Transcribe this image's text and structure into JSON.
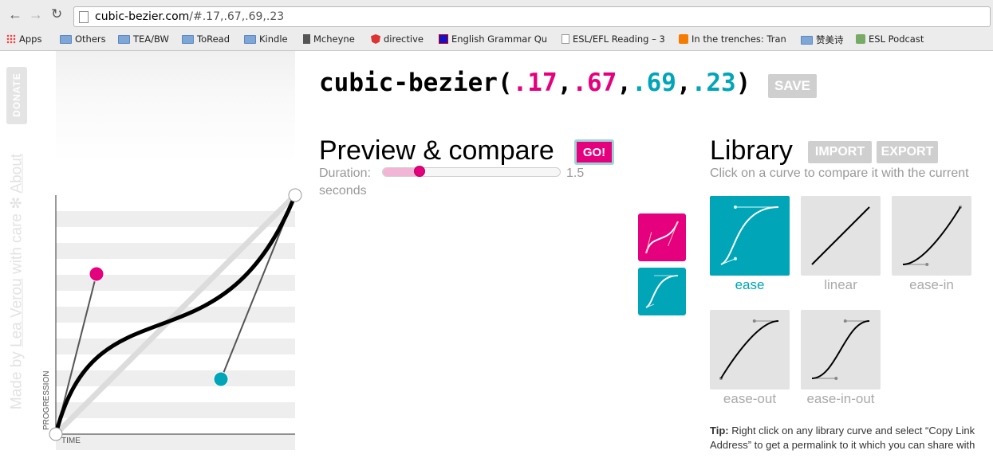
{
  "browser": {
    "url_host": "cubic-bezier.com",
    "url_rest": "/#.17,.67,.69,.23",
    "bookmarks": [
      "Apps",
      "Others",
      "TEA/BW",
      "ToRead",
      "Kindle",
      "Mcheyne",
      "directive",
      "English Grammar Qu",
      "ESL/EFL Reading – 3",
      "In the trenches: Tran",
      "赞美诗",
      "ESL Podcast"
    ]
  },
  "sidebar": {
    "donate": "DONATE",
    "made_by": "Made by",
    "author": "Lea Verou",
    "with_care": "with care",
    "star": "✻",
    "about": "About"
  },
  "graph": {
    "y_label": "PROGRESSION",
    "x_label": "TIME",
    "p1": [
      0.17,
      0.67
    ],
    "p2": [
      0.69,
      0.23
    ],
    "p1_color": "#e5007d",
    "p2_color": "#00a5b7"
  },
  "header": {
    "prefix": "cubic-bezier(",
    "v1": ".17",
    "c1": ",",
    "v2": ".67",
    "c2": ",",
    "v3": ".69",
    "c3": ",",
    "v4": ".23",
    "suffix": ")",
    "save": "SAVE"
  },
  "preview": {
    "heading": "Preview & compare",
    "go": "GO!",
    "duration_label": "Duration:",
    "duration_value": "1.5",
    "duration_unit": "seconds",
    "duration_fraction": 0.15
  },
  "library": {
    "heading": "Library",
    "import": "IMPORT",
    "export": "EXPORT",
    "instruction": "Click on a curve to compare it with the current",
    "items": [
      {
        "label": "ease",
        "selected": true,
        "curve": [
          0.25,
          0.1,
          0.25,
          1
        ]
      },
      {
        "label": "linear",
        "selected": false,
        "curve": [
          0,
          0,
          1,
          1
        ]
      },
      {
        "label": "ease-in",
        "selected": false,
        "curve": [
          0.42,
          0,
          1,
          1
        ]
      },
      {
        "label": "ease-out",
        "selected": false,
        "curve": [
          0,
          0,
          0.58,
          1
        ]
      },
      {
        "label": "ease-in-out",
        "selected": false,
        "curve": [
          0.42,
          0,
          0.58,
          1
        ]
      }
    ],
    "tip_label": "Tip:",
    "tip_line1": "Right click on any library curve and select “Copy Link",
    "tip_line2": "Address” to get a permalink to it which you can share with"
  },
  "colors": {
    "accent_pink": "#e5007d",
    "accent_teal": "#00a5b7"
  }
}
